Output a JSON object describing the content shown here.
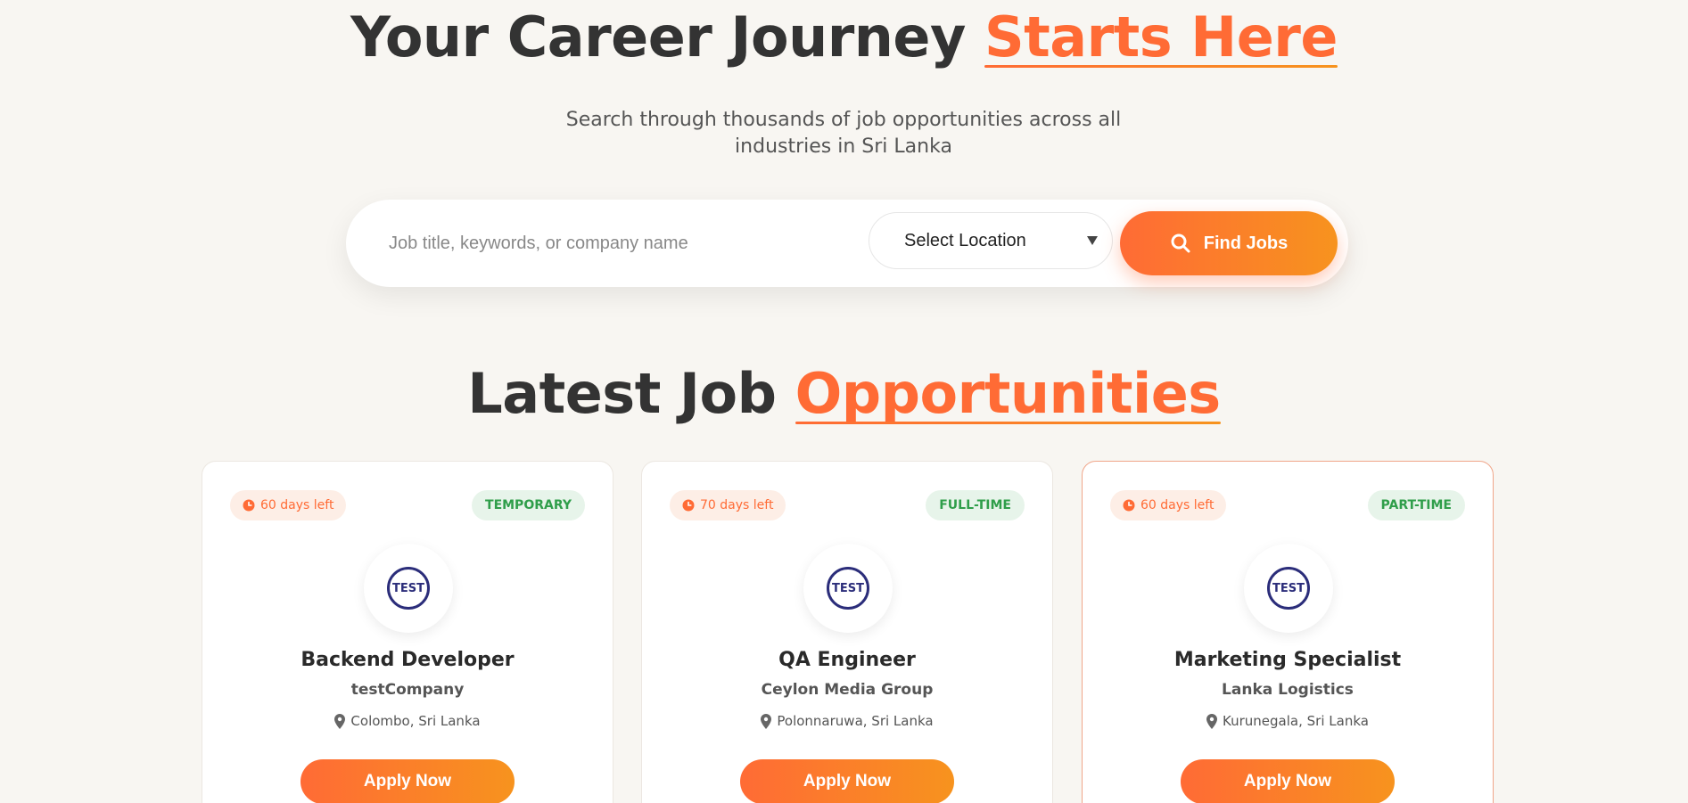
{
  "hero": {
    "title_main": "Your Career Journey ",
    "title_accent": "Starts Here",
    "subtitle": "Search through thousands of job opportunities across all industries in Sri Lanka"
  },
  "search": {
    "placeholder": "Job title, keywords, or company name",
    "location_selected": "Select Location",
    "find_label": "Find Jobs",
    "find_icon": "search-icon"
  },
  "section": {
    "title_main": "Latest Job ",
    "title_accent": "Opportunities"
  },
  "colors": {
    "accent": "#ff6b35",
    "accent_end": "#f7931e",
    "type_badge_text": "#2f9e4a",
    "type_badge_bg": "#e7f4ea",
    "days_badge_bg": "#fdeee6",
    "logo_color": "#2b2d7a"
  },
  "jobs": [
    {
      "days_left": "60 days left",
      "type": "TEMPORARY",
      "logo_text": "TEST",
      "title": "Backend Developer",
      "company": "testCompany",
      "location": "Colombo, Sri Lanka",
      "apply_label": "Apply Now"
    },
    {
      "days_left": "70 days left",
      "type": "FULL-TIME",
      "logo_text": "TEST",
      "title": "QA Engineer",
      "company": "Ceylon Media Group",
      "location": "Polonnaruwa, Sri Lanka",
      "apply_label": "Apply Now"
    },
    {
      "days_left": "60 days left",
      "type": "PART-TIME",
      "logo_text": "TEST",
      "title": "Marketing Specialist",
      "company": "Lanka Logistics",
      "location": "Kurunegala, Sri Lanka",
      "apply_label": "Apply Now"
    }
  ]
}
